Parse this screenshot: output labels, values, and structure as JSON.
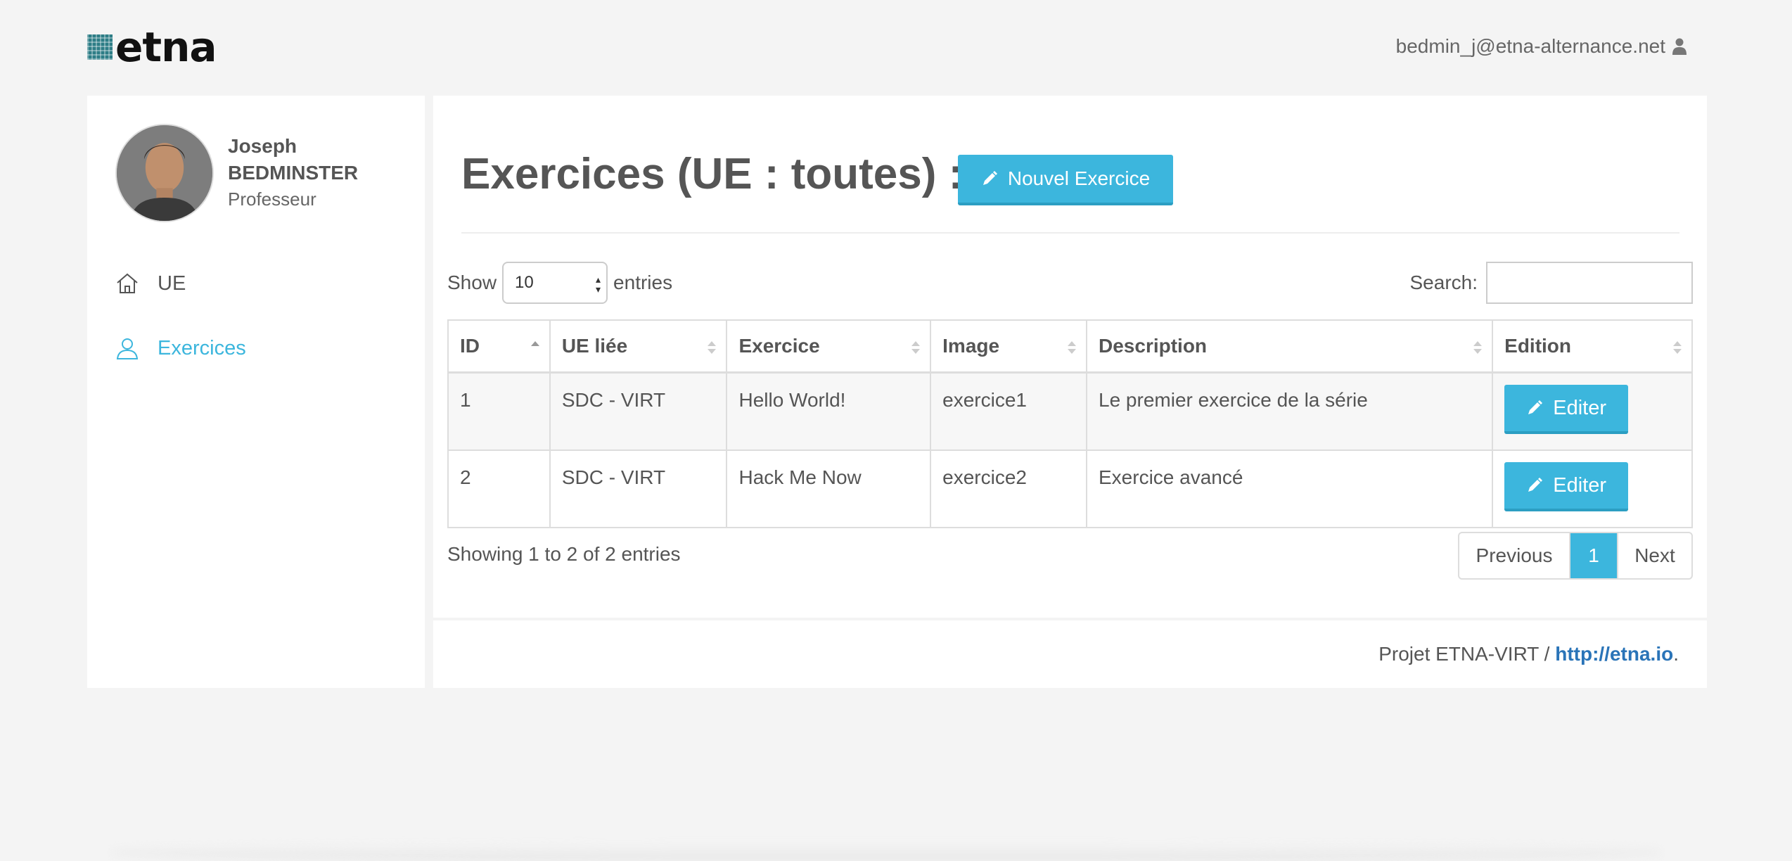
{
  "header": {
    "logo_text": "etna",
    "user_email": "bedmin_j@etna-alternance.net"
  },
  "sidebar": {
    "profile": {
      "first_name": "Joseph",
      "last_name": "BEDMINSTER",
      "role": "Professeur"
    },
    "items": [
      {
        "label": "UE",
        "icon": "home-icon",
        "active": false
      },
      {
        "label": "Exercices",
        "icon": "user-icon",
        "active": true
      }
    ]
  },
  "main": {
    "title": "Exercices (UE : toutes) :",
    "new_button_label": "Nouvel Exercice",
    "length": {
      "show_label": "Show",
      "value": "10",
      "entries_label": "entries"
    },
    "search_label": "Search:",
    "table": {
      "columns": [
        "ID",
        "UE liée",
        "Exercice",
        "Image",
        "Description",
        "Edition"
      ],
      "rows": [
        {
          "id": "1",
          "ue": "SDC - VIRT",
          "exercice": "Hello World!",
          "image": "exercice1",
          "description": "Le premier exercice de la série",
          "action": "Editer"
        },
        {
          "id": "2",
          "ue": "SDC - VIRT",
          "exercice": "Hack Me Now",
          "image": "exercice2",
          "description": "Exercice avancé",
          "action": "Editer"
        }
      ]
    },
    "info": "Showing 1 to 2 of 2 entries",
    "pagination": {
      "previous": "Previous",
      "current": "1",
      "next": "Next"
    }
  },
  "footer": {
    "text": "Projet ETNA-VIRT / ",
    "link": "http://etna.io",
    "suffix": "."
  },
  "colors": {
    "accent": "#3cb6dd",
    "link": "#2a74b8",
    "background": "#f4f4f4"
  }
}
